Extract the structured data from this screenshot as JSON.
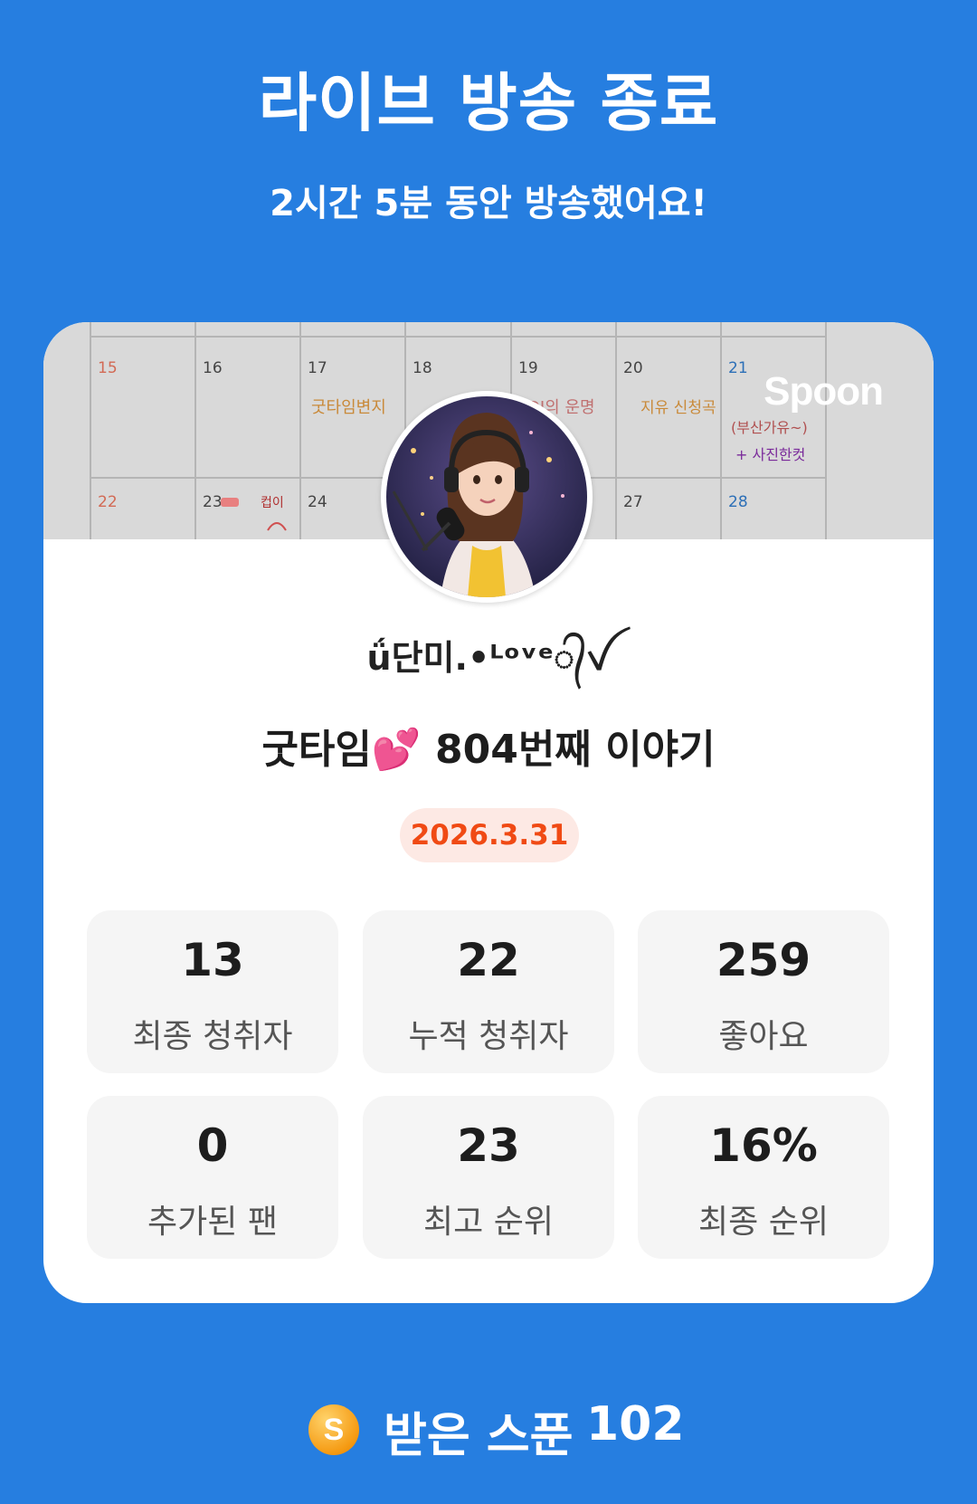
{
  "header": {
    "title": "라이브 방송 종료",
    "subtitle": "2시간 5분 동안 방송했어요!"
  },
  "card": {
    "banner_logo": "Spoon",
    "dj_name": "ǘ단미.•ᴸᵒᵛᵉ᭄ꪜ",
    "broadcast_title": "굿타임💕 804번째 이야기",
    "date": "2026.3.31",
    "stats": [
      {
        "value": "13",
        "label": "최종 청취자"
      },
      {
        "value": "22",
        "label": "누적 청취자"
      },
      {
        "value": "259",
        "label": "좋아요"
      },
      {
        "value": "0",
        "label": "추가된 팬"
      },
      {
        "value": "23",
        "label": "최고 순위"
      },
      {
        "value": "16%",
        "label": "최종 순위"
      }
    ],
    "calendar_days": [
      "15",
      "16",
      "17",
      "18",
      "19",
      "20",
      "21",
      "22",
      "23",
      "24",
      "27",
      "28"
    ],
    "calendar_notes": [
      "굿타임변지",
      "DJ의 운명",
      "지유 신청곡",
      "(부산가유~)",
      "+ 사진한컷",
      "컵이"
    ]
  },
  "footer": {
    "icon": "spoon-coin-icon",
    "icon_letter": "S",
    "label": "받은 스푼",
    "value": "102"
  },
  "colors": {
    "background": "#267ee0",
    "card": "#ffffff",
    "stat_box": "#f5f5f5",
    "date_badge_bg": "#fde9e4",
    "date_badge_text": "#f04a14",
    "coin": "#f59a12"
  }
}
